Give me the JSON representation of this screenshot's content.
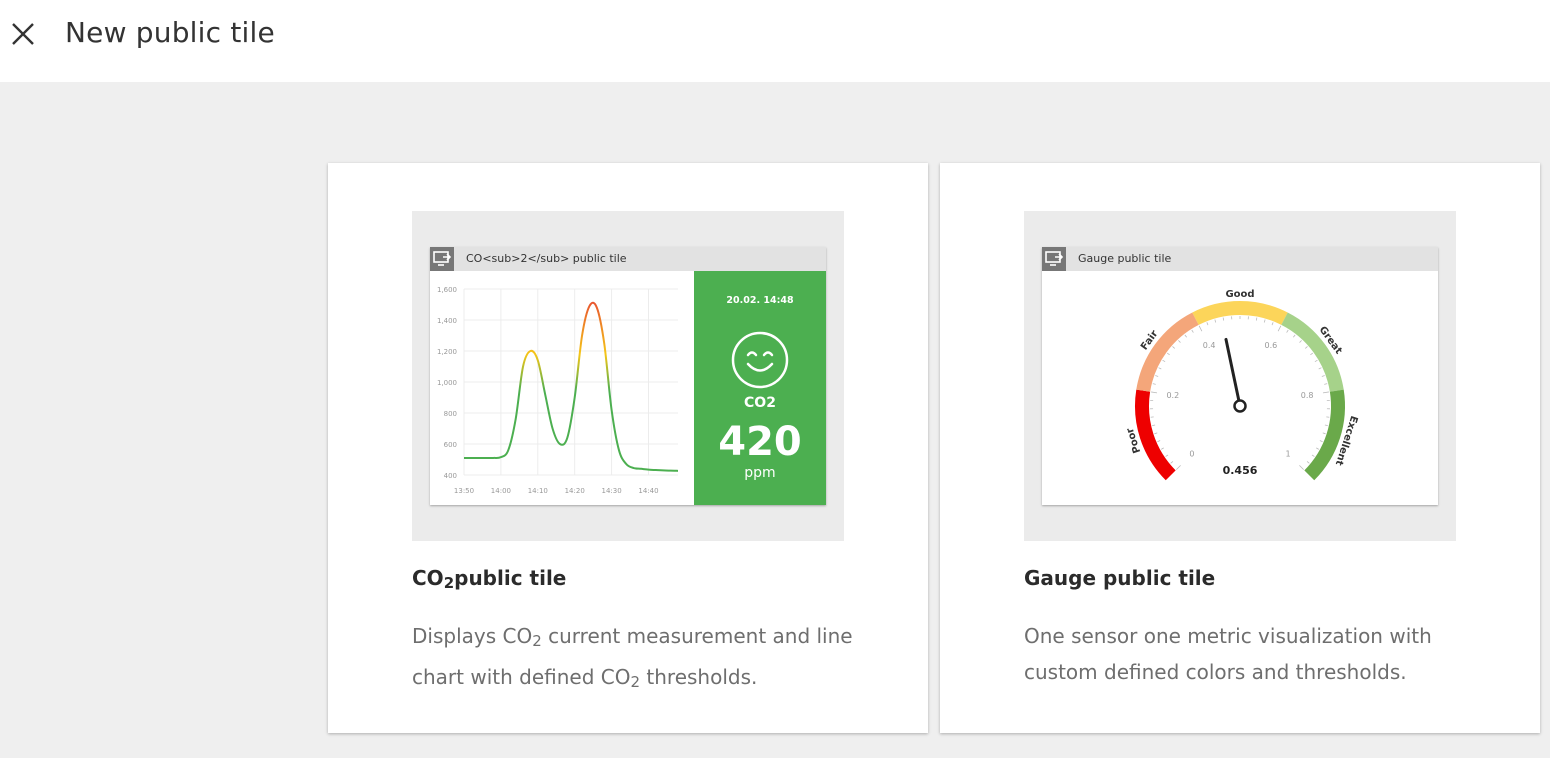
{
  "header": {
    "title": "New public tile",
    "close_icon": "close-icon"
  },
  "cards": [
    {
      "id": "co2",
      "title_main": "CO",
      "title_sub": "2",
      "title_rest": "public tile",
      "desc_part1": "Displays CO",
      "desc_sub1": "2",
      "desc_part2": " current measurement and line chart with defined CO",
      "desc_sub2": "2",
      "desc_part3": " thresholds.",
      "preview": {
        "tile_title": "CO<sub>2</sub> public tile",
        "header_icon": "monitor-share-icon",
        "date": "20.02. 14:48",
        "face_icon": "smiley-face-icon",
        "metric_label": "CO2",
        "value": "420",
        "unit": "ppm",
        "panel_color": "#4caf50"
      }
    },
    {
      "id": "gauge",
      "title": "Gauge public tile",
      "description": "One sensor one metric visualization with custom defined colors and thresholds.",
      "preview": {
        "tile_title": "Gauge public tile",
        "header_icon": "monitor-share-icon",
        "value": "0.456"
      }
    }
  ],
  "chart_data": [
    {
      "type": "line",
      "x": [
        "13:50",
        "13:52",
        "13:54",
        "13:56",
        "13:58",
        "14:00",
        "14:02",
        "14:04",
        "14:06",
        "14:08",
        "14:10",
        "14:12",
        "14:14",
        "14:16",
        "14:18",
        "14:20",
        "14:22",
        "14:24",
        "14:26",
        "14:28",
        "14:30",
        "14:32",
        "14:34",
        "14:36",
        "14:38",
        "14:40",
        "14:42",
        "14:44",
        "14:46",
        "14:48"
      ],
      "values": [
        510,
        510,
        510,
        510,
        510,
        515,
        560,
        760,
        1100,
        1200,
        1140,
        920,
        700,
        600,
        640,
        900,
        1300,
        1490,
        1480,
        1250,
        820,
        560,
        470,
        445,
        440,
        435,
        432,
        430,
        428,
        427
      ],
      "xticks": [
        "13:50",
        "14:00",
        "14:10",
        "14:20",
        "14:30",
        "14:40"
      ],
      "yticks": [
        "400",
        "600",
        "800",
        "1,000",
        "1,200",
        "1,400",
        "1,600"
      ],
      "ylim": [
        400,
        1600
      ],
      "grid": true,
      "line_colors": [
        "#4caf50",
        "#f5c518",
        "#e53935"
      ]
    },
    {
      "type": "gauge",
      "value": 0.456,
      "range": [
        0,
        1
      ],
      "ticks": [
        "0",
        "0.2",
        "0.4",
        "0.6",
        "0.8",
        "1"
      ],
      "bands": [
        {
          "name": "Poor",
          "from": 0,
          "to": 0.2,
          "color": "#ee0000"
        },
        {
          "name": "Fair",
          "from": 0.2,
          "to": 0.4,
          "color": "#f4a67a"
        },
        {
          "name": "Good",
          "from": 0.4,
          "to": 0.6,
          "color": "#fcd55a"
        },
        {
          "name": "Great",
          "from": 0.6,
          "to": 0.8,
          "color": "#a6d28a"
        },
        {
          "name": "Excellent",
          "from": 0.8,
          "to": 1.0,
          "color": "#6aa94a"
        }
      ]
    }
  ]
}
